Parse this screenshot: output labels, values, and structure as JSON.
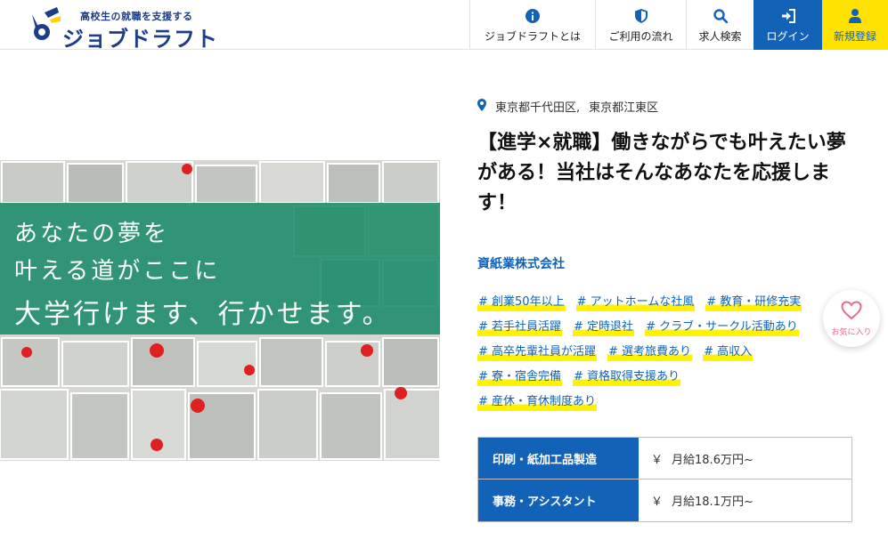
{
  "header": {
    "tagline": "高校生の就職を支援する",
    "brand": "ジョブドラフト",
    "nav": [
      {
        "label": "ジョブドラフトとは",
        "icon": "info-icon"
      },
      {
        "label": "ご利用の流れ",
        "icon": "shield-icon"
      },
      {
        "label": "求人検索",
        "icon": "search-icon"
      },
      {
        "label": "ログイン",
        "icon": "login-icon"
      },
      {
        "label": "新規登録",
        "icon": "user-icon"
      }
    ]
  },
  "hero": {
    "line1": "あなたの夢を",
    "line2": "叶える道がここに",
    "line3": "大学行けます、行かせます。"
  },
  "job": {
    "locations": [
      "東京都千代田区,",
      "東京都江東区"
    ],
    "title": "【進学×就職】働きながらでも叶えたい夢がある！当社はそんなあなたを応援します！",
    "company": "資紙業株式会社",
    "tag_rows": [
      [
        "# 創業50年以上",
        "# アットホームな社風",
        "# 教育・研修充実"
      ],
      [
        "# 若手社員活躍",
        "# 定時退社",
        "# クラブ・サークル活動あり"
      ],
      [
        "# 高卒先輩社員が活躍",
        "# 選考旅費あり",
        "# 高収入"
      ],
      [
        "# 寮・宿舎完備",
        "# 資格取得支援あり"
      ],
      [
        "# 産休・育休制度あり"
      ]
    ],
    "favorite_label": "お気に入り",
    "positions": [
      {
        "name": "印刷・紙加工品製造",
        "yen": "￥",
        "pay": "月給18.6万円~"
      },
      {
        "name": "事務・アシスタント",
        "yen": "￥",
        "pay": "月給18.1万円~"
      }
    ]
  },
  "colors": {
    "brand_blue": "#1263b8",
    "logo_navy": "#1d3c8a",
    "accent_yellow": "#ffe200",
    "hero_green": "#1a8c68",
    "favorite_pink": "#e86a8a"
  }
}
